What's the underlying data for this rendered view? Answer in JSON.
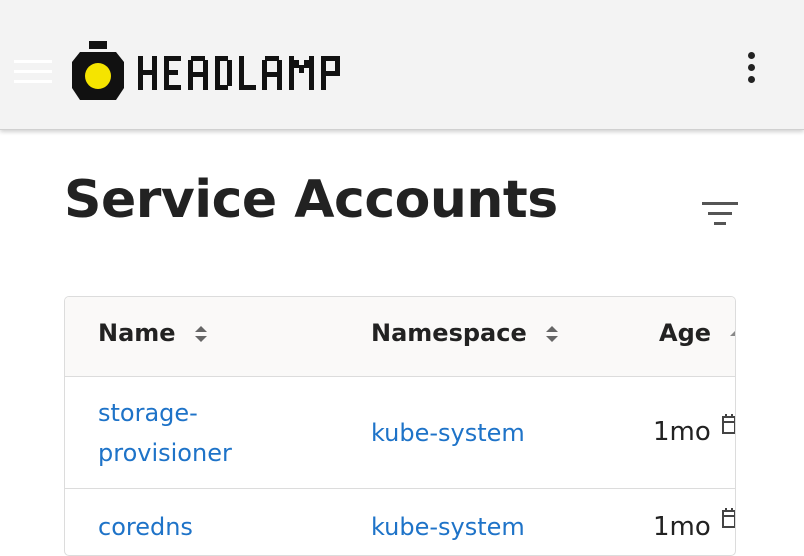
{
  "app": {
    "name": "HEADLAMP",
    "colors": {
      "logo_yellow": "#f5e400",
      "logo_black": "#111111",
      "link": "#1e73c8"
    }
  },
  "header": {
    "menu_icon": "hamburger-menu-icon",
    "more_icon": "kebab-menu-icon"
  },
  "page": {
    "title": "Service Accounts",
    "filter_icon": "filter-list-icon"
  },
  "table": {
    "columns": [
      "Name",
      "Namespace",
      "Age"
    ],
    "rows": [
      {
        "name_line1": "storage-",
        "name_line2": "provisioner",
        "namespace": "kube-system",
        "age": "1mo"
      },
      {
        "name_line1": "coredns",
        "name_line2": "",
        "namespace": "kube-system",
        "age": "1mo"
      }
    ]
  }
}
